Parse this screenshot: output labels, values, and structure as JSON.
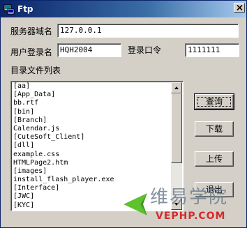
{
  "window": {
    "title": "Ftp"
  },
  "form": {
    "server_label": "服务器域名",
    "server_value": "127.0.0.1",
    "user_label": "用户登录名",
    "user_value": "HQH2004",
    "password_label": "登录口令",
    "password_value": "1111111",
    "dir_list_label": "目录文件列表"
  },
  "file_list": [
    "[aa]",
    "[App_Data]",
    "bb.rtf",
    "[bin]",
    "[Branch]",
    "Calendar.js",
    "[CuteSoft_Client]",
    "[dll]",
    "example.css",
    "HTMLPage2.htm",
    "[images]",
    "install_flash_player.exe",
    "[Interface]",
    "[JWC]",
    "[KYC]"
  ],
  "buttons": {
    "query": "查询",
    "download": "下载",
    "upload": "上传",
    "exit": "退出"
  },
  "watermark": {
    "text_cn": "维易学院",
    "text_en": "VEPHP.COM",
    "colors": {
      "logo_green": "#4cbb17",
      "text_en": "#d42b2b"
    }
  },
  "icons": {
    "app": "ftp-app-icon",
    "close": "close-icon",
    "scroll_up": "scroll-up-arrow-icon",
    "scroll_down": "scroll-down-arrow-icon"
  }
}
